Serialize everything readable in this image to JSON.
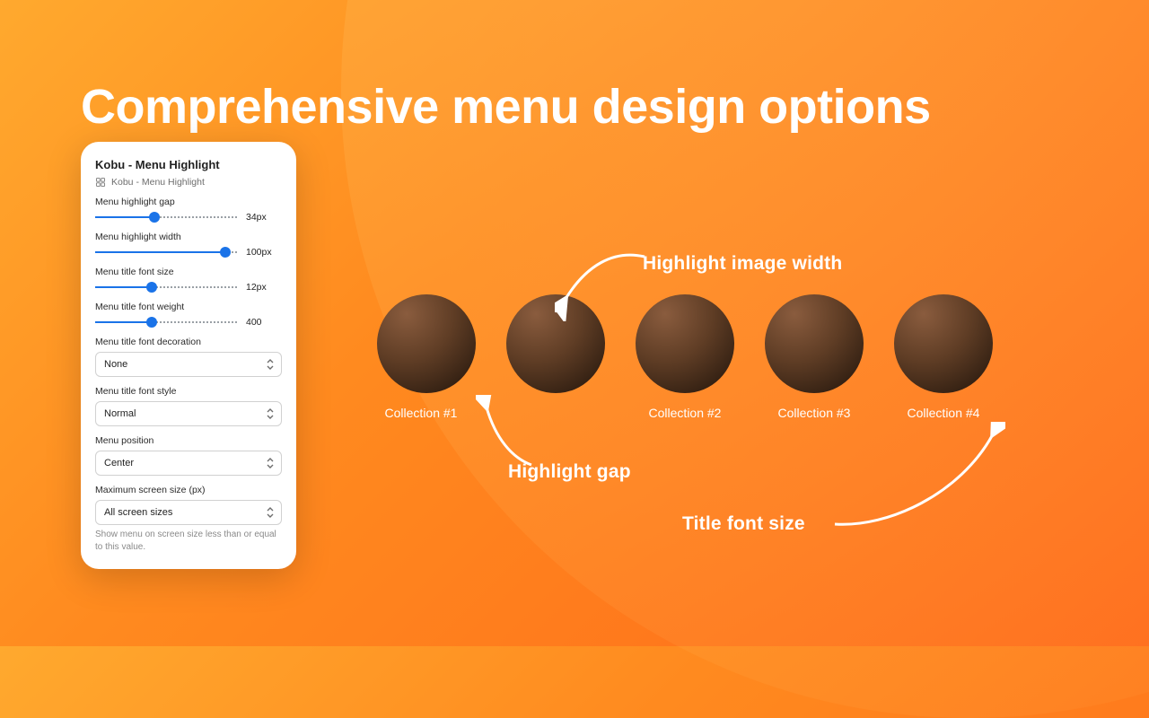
{
  "headline": "Comprehensive menu design options",
  "panel": {
    "title": "Kobu - Menu Highlight",
    "breadcrumb": "Kobu - Menu Highlight",
    "sliders": {
      "highlight_gap": {
        "label": "Menu highlight gap",
        "value_text": "34px",
        "pct": 42
      },
      "highlight_width": {
        "label": "Menu highlight width",
        "value_text": "100px",
        "pct": 92
      },
      "title_font_size": {
        "label": "Menu title font size",
        "value_text": "12px",
        "pct": 40
      },
      "title_font_weight": {
        "label": "Menu title font weight",
        "value_text": "400",
        "pct": 40
      }
    },
    "selects": {
      "decoration": {
        "label": "Menu title font decoration",
        "value": "None"
      },
      "style": {
        "label": "Menu title font style",
        "value": "Normal"
      },
      "position": {
        "label": "Menu position",
        "value": "Center"
      },
      "max_screen": {
        "label": "Maximum screen size (px)",
        "value": "All screen sizes",
        "helper": "Show menu on screen size less than or equal to this value."
      }
    }
  },
  "annotations": {
    "highlight_width": "Highlight image width",
    "highlight_gap": "Highlight gap",
    "title_font_size": "Title font size"
  },
  "preview": {
    "items": [
      {
        "label": "Collection #1"
      },
      {
        "label": ""
      },
      {
        "label": "Collection #2"
      },
      {
        "label": "Collection #3"
      },
      {
        "label": "Collection #4"
      }
    ]
  }
}
